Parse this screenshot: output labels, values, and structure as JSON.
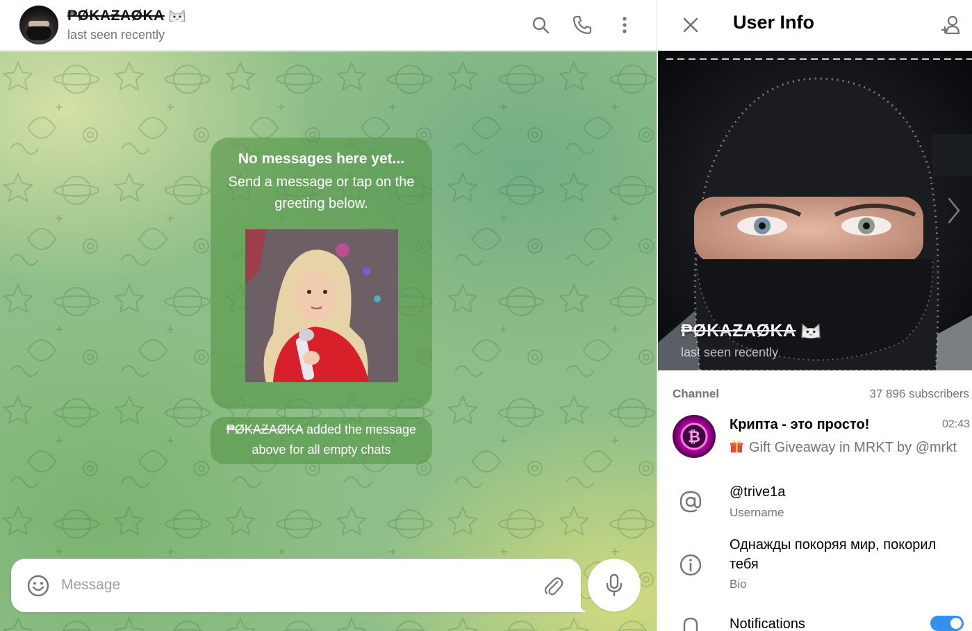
{
  "chat": {
    "header": {
      "name": "₱ØKAƵAØKA",
      "name_emoji": "cat-emoji",
      "status": "last seen recently",
      "actions": [
        "search-icon",
        "phone-icon",
        "more-vertical-icon"
      ]
    },
    "empty_state": {
      "title": "No messages here yet...",
      "text": "Send a message or tap on the greeting below.",
      "sticker": "girl-with-microphone-sticker"
    },
    "service_message": {
      "actor": "₱ØKAƵAØKA",
      "text": " added the message above for all empty chats"
    },
    "composer": {
      "placeholder": "Message",
      "emoji_icon": "smile-icon",
      "attach_icon": "paperclip-icon",
      "mic_icon": "microphone-icon"
    }
  },
  "panel": {
    "title": "User Info",
    "close_icon": "close-icon",
    "add_contact_icon": "add-contact-icon",
    "photo": {
      "name": "₱ØKAƵAØKA",
      "status": "last seen recently"
    },
    "channel_section": {
      "label": "Channel",
      "subscribers": "37 896 subscribers",
      "channel": {
        "name": "Крипта - это просто!",
        "time": "02:43",
        "preview": "Gift Giveaway in MRKT by @mrkt",
        "preview_icon": "gift-icon"
      }
    },
    "username": {
      "value": "@trive1a",
      "label": "Username"
    },
    "bio": {
      "value": "Однажды покоряя мир, покорил тебя",
      "label": "Bio"
    },
    "notifications": {
      "label": "Notifications",
      "enabled": true
    }
  },
  "colors": {
    "accent": "#3390ec",
    "secondary_text": "#707579",
    "bubble_green": "#569648"
  }
}
